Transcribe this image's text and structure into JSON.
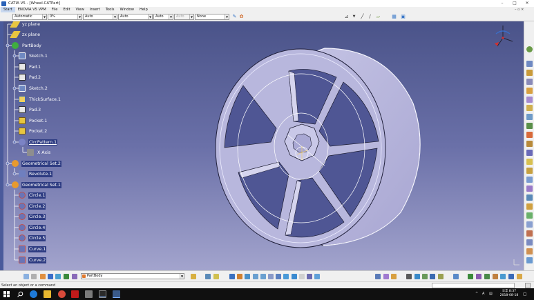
{
  "window": {
    "title": "CATIA V5 - [Wheel.CATPart]",
    "minimize": "–",
    "maximize": "□",
    "close": "✕"
  },
  "menubar": {
    "items": [
      "Start",
      "ENOVIA V5 VPM",
      "File",
      "Edit",
      "View",
      "Insert",
      "Tools",
      "Window",
      "Help"
    ],
    "mdi_controls": "– ▫ ×"
  },
  "toolbar_top": {
    "graphic_style": "Automatic",
    "transparency": "0%",
    "line_thickness": "Auto",
    "line_type": "Auto",
    "point_style": "Auto",
    "layer_disabled": "Auto",
    "layer": "None"
  },
  "tree": {
    "items": [
      {
        "label": "yz plane",
        "icon": "plane-icon",
        "color": "#e8c640"
      },
      {
        "label": "zx plane",
        "icon": "plane-icon",
        "color": "#e8c640"
      },
      {
        "label": "PartBody",
        "icon": "partbody-icon",
        "color": "#3fae3f"
      },
      {
        "label": "Sketch.1",
        "icon": "sketch-icon",
        "color": "#6f89c2"
      },
      {
        "label": "Pad.1",
        "icon": "pad-icon",
        "color": "#e7e7e7"
      },
      {
        "label": "Pad.2",
        "icon": "pad-icon",
        "color": "#e7e7e7"
      },
      {
        "label": "Sketch.2",
        "icon": "sketch-icon",
        "color": "#6f89c2"
      },
      {
        "label": "ThickSurface.1",
        "icon": "thick-surface-icon",
        "color": "#f0d060"
      },
      {
        "label": "Pad.3",
        "icon": "pad-icon",
        "color": "#e7e7e7"
      },
      {
        "label": "Pocket.1",
        "icon": "pocket-icon",
        "color": "#e8c640"
      },
      {
        "label": "Pocket.2",
        "icon": "pocket-icon",
        "color": "#e8c640"
      },
      {
        "label": "CircPattern.1",
        "icon": "circ-pattern-icon",
        "color": "#7b83c5"
      },
      {
        "label": "X Axis",
        "icon": "axis-icon",
        "color": "#8e8e8e"
      },
      {
        "label": "Geometrical Set.2",
        "icon": "geometrical-set-icon",
        "color": "#e89a2e"
      },
      {
        "label": "Revolute.1",
        "icon": "revolute-icon",
        "color": "#6f7fbf"
      },
      {
        "label": "Geometrical Set.1",
        "icon": "geometrical-set-icon",
        "color": "#e89a2e"
      },
      {
        "label": "Circle.1",
        "icon": "circle-icon",
        "color": "#c0504d"
      },
      {
        "label": "Circle.2",
        "icon": "circle-icon",
        "color": "#c0504d"
      },
      {
        "label": "Circle.3",
        "icon": "circle-icon",
        "color": "#c0504d"
      },
      {
        "label": "Circle.4",
        "icon": "circle-icon",
        "color": "#c0504d"
      },
      {
        "label": "Circle.5",
        "icon": "circle-icon",
        "color": "#c0504d"
      },
      {
        "label": "Curve.1",
        "icon": "curve-icon",
        "color": "#c0504d"
      },
      {
        "label": "Curve.2",
        "icon": "curve-icon",
        "color": "#c0504d"
      }
    ]
  },
  "bottom_toolbar": {
    "current_body": "PartBody"
  },
  "status": {
    "message": "Select an object or a command"
  },
  "taskbar": {
    "tray_lang": "A",
    "clock_time": "오후 8:37",
    "clock_date": "2018-08-18"
  },
  "colors": {
    "viewport_top": "#4a5389",
    "viewport_bottom": "#a3a4cd",
    "model_fill": "#b7b6dc",
    "selection_highlight": "#2e3c82"
  }
}
